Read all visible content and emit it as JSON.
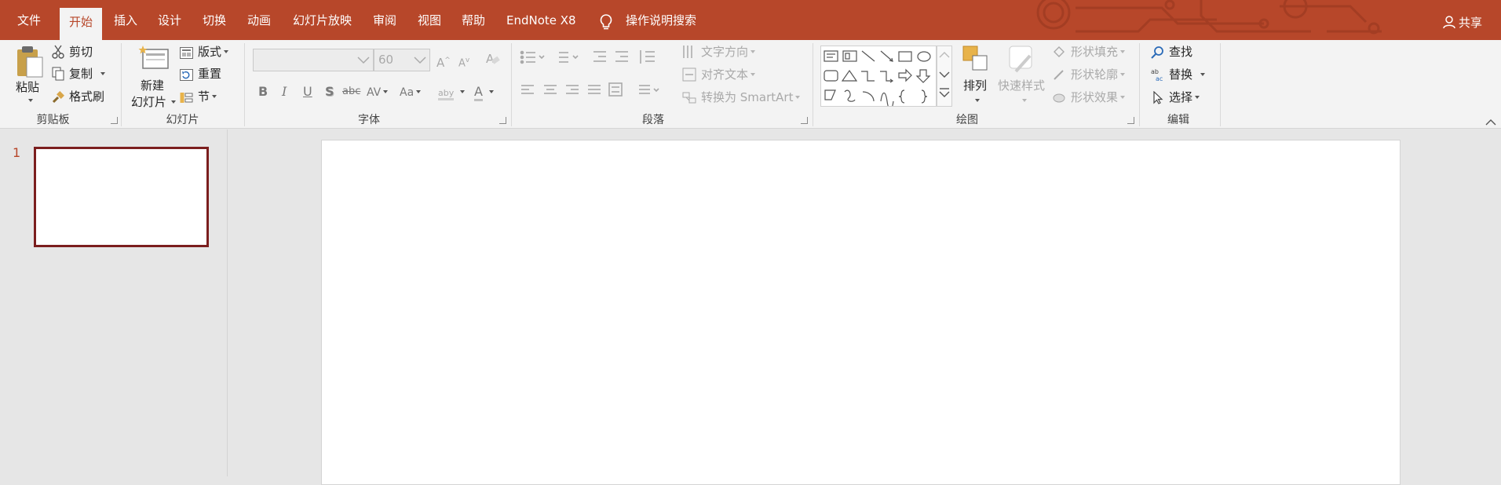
{
  "tabs": [
    {
      "label": "文件",
      "active": false
    },
    {
      "label": "开始",
      "active": true
    },
    {
      "label": "插入",
      "active": false
    },
    {
      "label": "设计",
      "active": false
    },
    {
      "label": "切换",
      "active": false
    },
    {
      "label": "动画",
      "active": false
    },
    {
      "label": "幻灯片放映",
      "active": false
    },
    {
      "label": "审阅",
      "active": false
    },
    {
      "label": "视图",
      "active": false
    },
    {
      "label": "帮助",
      "active": false
    },
    {
      "label": "EndNote X8",
      "active": false
    }
  ],
  "tell_me": {
    "label": "操作说明搜索",
    "icon": "lightbulb-icon"
  },
  "share": {
    "label": "共享",
    "icon": "person-icon"
  },
  "ribbon": {
    "clipboard": {
      "label": "剪贴板",
      "paste": "粘贴",
      "cut": "剪切",
      "copy": "复制",
      "format_painter": "格式刷"
    },
    "slides": {
      "label": "幻灯片",
      "new_slide_line1": "新建",
      "new_slide_line2": "幻灯片",
      "layout": "版式",
      "reset": "重置",
      "section": "节"
    },
    "font": {
      "label": "字体",
      "font_name": "",
      "font_size": "60",
      "grow": "A",
      "shrink": "A",
      "bold": "B",
      "italic": "I",
      "underline": "U",
      "shadow": "S",
      "strike": "abc",
      "spacing": "AV",
      "case": "Aa",
      "highlight": "aby",
      "color": "A"
    },
    "paragraph": {
      "label": "段落",
      "text_direction": "文字方向",
      "align_text": "对齐文本",
      "smartart": "转换为 SmartArt"
    },
    "drawing": {
      "label": "绘图",
      "arrange": "排列",
      "quick_styles": "快速样式",
      "shape_fill": "形状填充",
      "shape_outline": "形状轮廓",
      "shape_effects": "形状效果"
    },
    "editing": {
      "label": "编辑",
      "find": "查找",
      "replace": "替换",
      "select": "选择"
    }
  },
  "thumbnails": [
    {
      "number": "1"
    }
  ],
  "colors": {
    "accent": "#b7472a",
    "ribbon_bg": "#f3f3f3",
    "workspace_bg": "#e6e6e6",
    "thumb_border": "#7b1e1e"
  }
}
